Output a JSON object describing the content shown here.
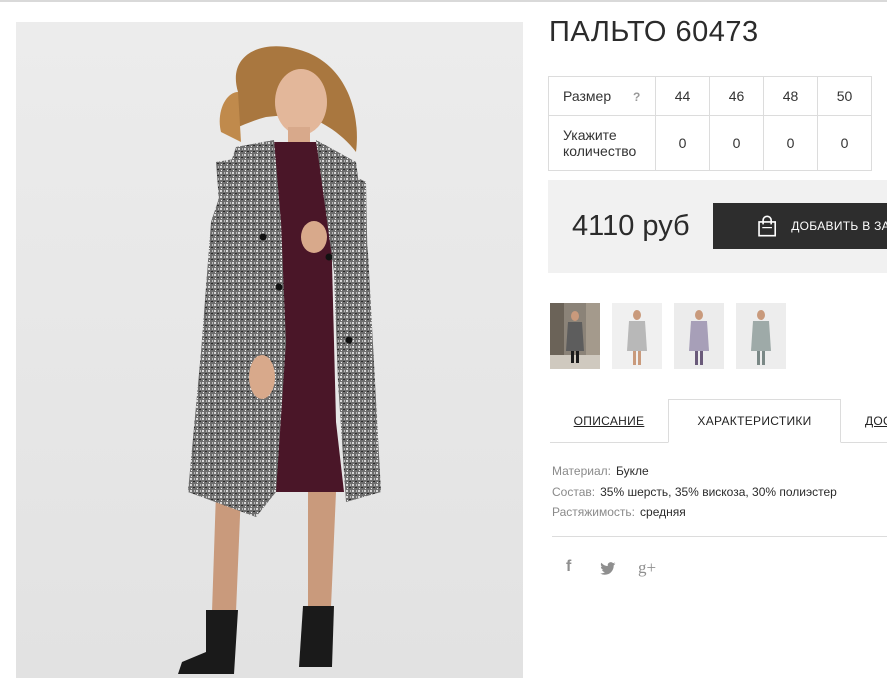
{
  "product": {
    "title": "ПАЛЬТО 60473"
  },
  "size_table": {
    "size_label": "Размер",
    "help_mark": "?",
    "qty_label_line1": "Укажите",
    "qty_label_line2": "количество",
    "sizes": [
      "44",
      "46",
      "48",
      "50"
    ],
    "quantities": [
      "0",
      "0",
      "0",
      "0"
    ]
  },
  "purchase": {
    "price": "4110 руб",
    "add_to_cart_label": "ДОБАВИТЬ В ЗАКАЗ"
  },
  "tabs": {
    "description": "ОПИСАНИЕ",
    "characteristics": "ХАРАКТЕРИСТИКИ",
    "delivery": "ДОСТАВКА"
  },
  "specs": [
    {
      "key": "Материал:",
      "value": "Букле"
    },
    {
      "key": "Состав:",
      "value": "35% шерсть, 35% вискоза, 30% полиэстер"
    },
    {
      "key": "Растяжимость:",
      "value": "средняя"
    }
  ],
  "social": {
    "facebook": "f",
    "google_plus": "g+"
  },
  "colors": {
    "coat": "#6a6a6a",
    "dress": "#4a1628",
    "button_bg": "#2d2d2d",
    "buybar_bg": "#f1f1f1"
  }
}
